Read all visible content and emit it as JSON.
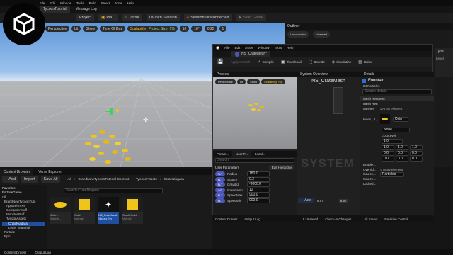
{
  "main_menu": {
    "items": [
      "File",
      "Edit",
      "Window",
      "Tools",
      "Build",
      "Select",
      "Actor",
      "Help"
    ],
    "file_tab": "TycoonTutorial",
    "message_tab": "Message Log"
  },
  "main_toolbar": {
    "project": "Project",
    "platforms": "Pla...",
    "verse": "Verse",
    "launch": "Launch Session",
    "session": "Session Disconnected",
    "start_game": "Start Game"
  },
  "viewport": {
    "perspective": "Perspective",
    "lit": "Lit",
    "show": "Show",
    "time_of_day": "Time Of Day",
    "scalability": "Scalability: High",
    "project_size": "Project Size: 1%",
    "snap_grid": "10",
    "snap_angle": "10°",
    "snap_scale": "0.25",
    "camera_speed": "1"
  },
  "outliner": {
    "title": "Outliner",
    "filter_tabs": [
      "Uncontrolled",
      "Unsaved"
    ],
    "type_header": "Type",
    "type_value": "Level"
  },
  "niagara": {
    "title": "NS_CrateMesh*",
    "menu": [
      "File",
      "Edit",
      "Asset",
      "Window",
      "Tools",
      "Help"
    ],
    "toolbar": {
      "save": "",
      "apply": "Apply Scratch",
      "compile": "Compile",
      "thumbnail": "Thumbnail",
      "bounds": "Bounds",
      "simulation": "Simulation",
      "baker": "Baker"
    },
    "preview": {
      "tab": "Preview",
      "perspective": "Perspective",
      "lit": "Lit",
      "show": "Show",
      "scalability": "Scalability: Hig"
    },
    "system_overview": {
      "tab": "System Overview",
      "title": "NS_CrateMesh",
      "watermark": "SYSTEM",
      "add_label": "Add",
      "counter_left": "6.57",
      "counter_right": "6.57"
    },
    "bottom_tabs": [
      "Param...",
      "User P...",
      "Local..."
    ],
    "user_params": {
      "search": "Search",
      "header": "User Parameters",
      "edit_hierarchy": "Edit Hierarchy",
      "rows": [
        {
          "name": "Radius",
          "value": "180.0"
        },
        {
          "name": "Source",
          "value": "0.3"
        },
        {
          "name": "GravityZ",
          "value": "-9000.0"
        },
        {
          "name": "spawnamo",
          "value": "12"
        },
        {
          "name": "SpeedMax",
          "value": "900.0"
        },
        {
          "name": "SpeedMin",
          "value": "900.0"
        }
      ]
    },
    "details": {
      "tab": "Details",
      "emitter": "Fountain",
      "particles": "24 Particles",
      "search": "Search details",
      "mesh_renderer": "Mesh Renderer",
      "mesh_rendering": "Mesh Ren",
      "meshes_label": "Meshes",
      "meshes_value": "1 Array element",
      "index_label": "Index [ 0 ]",
      "mesh_field": "Coin_",
      "none": "None",
      "lod_label": "LODLevel",
      "lod_value": "1.0",
      "vec_rows": [
        [
          "1.0",
          "1.0",
          "1.0"
        ],
        [
          "0.0",
          "0.0",
          "0.0"
        ],
        [
          "0.0",
          "0.0",
          "0.0"
        ]
      ],
      "props": [
        "Enable...",
        "Overrid...",
        "Source...",
        "Source...",
        "Locked..."
      ],
      "override_value": "0 Array element",
      "source_value": "Particles"
    }
  },
  "content_browser": {
    "tab": "Content Browser",
    "verse_tab": "Verse Explorer",
    "add": "Add",
    "import": "Import",
    "save_all": "Save All",
    "all": "All",
    "breadcrumb": [
      "BrandNewTycoonTutorial Content",
      "TycoonAssets",
      "CrateNiagara"
    ],
    "search": "Search CrateNiagara",
    "favorites": "Favorites",
    "project": "FortniteGame",
    "tree": [
      "All",
      "BrandNewTycoonTuto",
      "ApparelVFXs",
      "ComputerStuff",
      "MonsterStuff",
      "TycoonAssets",
      "CrateNiagara",
      "Letter_Material",
      "Fortnite",
      "Epic"
    ],
    "assets": [
      {
        "name": "Coin...",
        "type": "Static M..."
      },
      {
        "name": "Gold",
        "type": "Material"
      },
      {
        "name": "NS_CrateMesh",
        "type": "Niagara Sys"
      },
      {
        "name": "Smolt Gold",
        "type": "Material"
      }
    ]
  },
  "status_bar": {
    "content_drawer": "Content Drawer",
    "output_log": "Output Log",
    "unsaved": "5 Unsaved",
    "check_in": "Check-in Changes",
    "all_saved": "All Saved",
    "revision": "Revision Control"
  },
  "colors": {
    "accent_blue": "#2f6bd8",
    "niagara_badge": "#4b56b6",
    "coin_gold": "#f0c418",
    "sky_top": "#5c96d9",
    "highlight_row": "#1f4fa1"
  }
}
